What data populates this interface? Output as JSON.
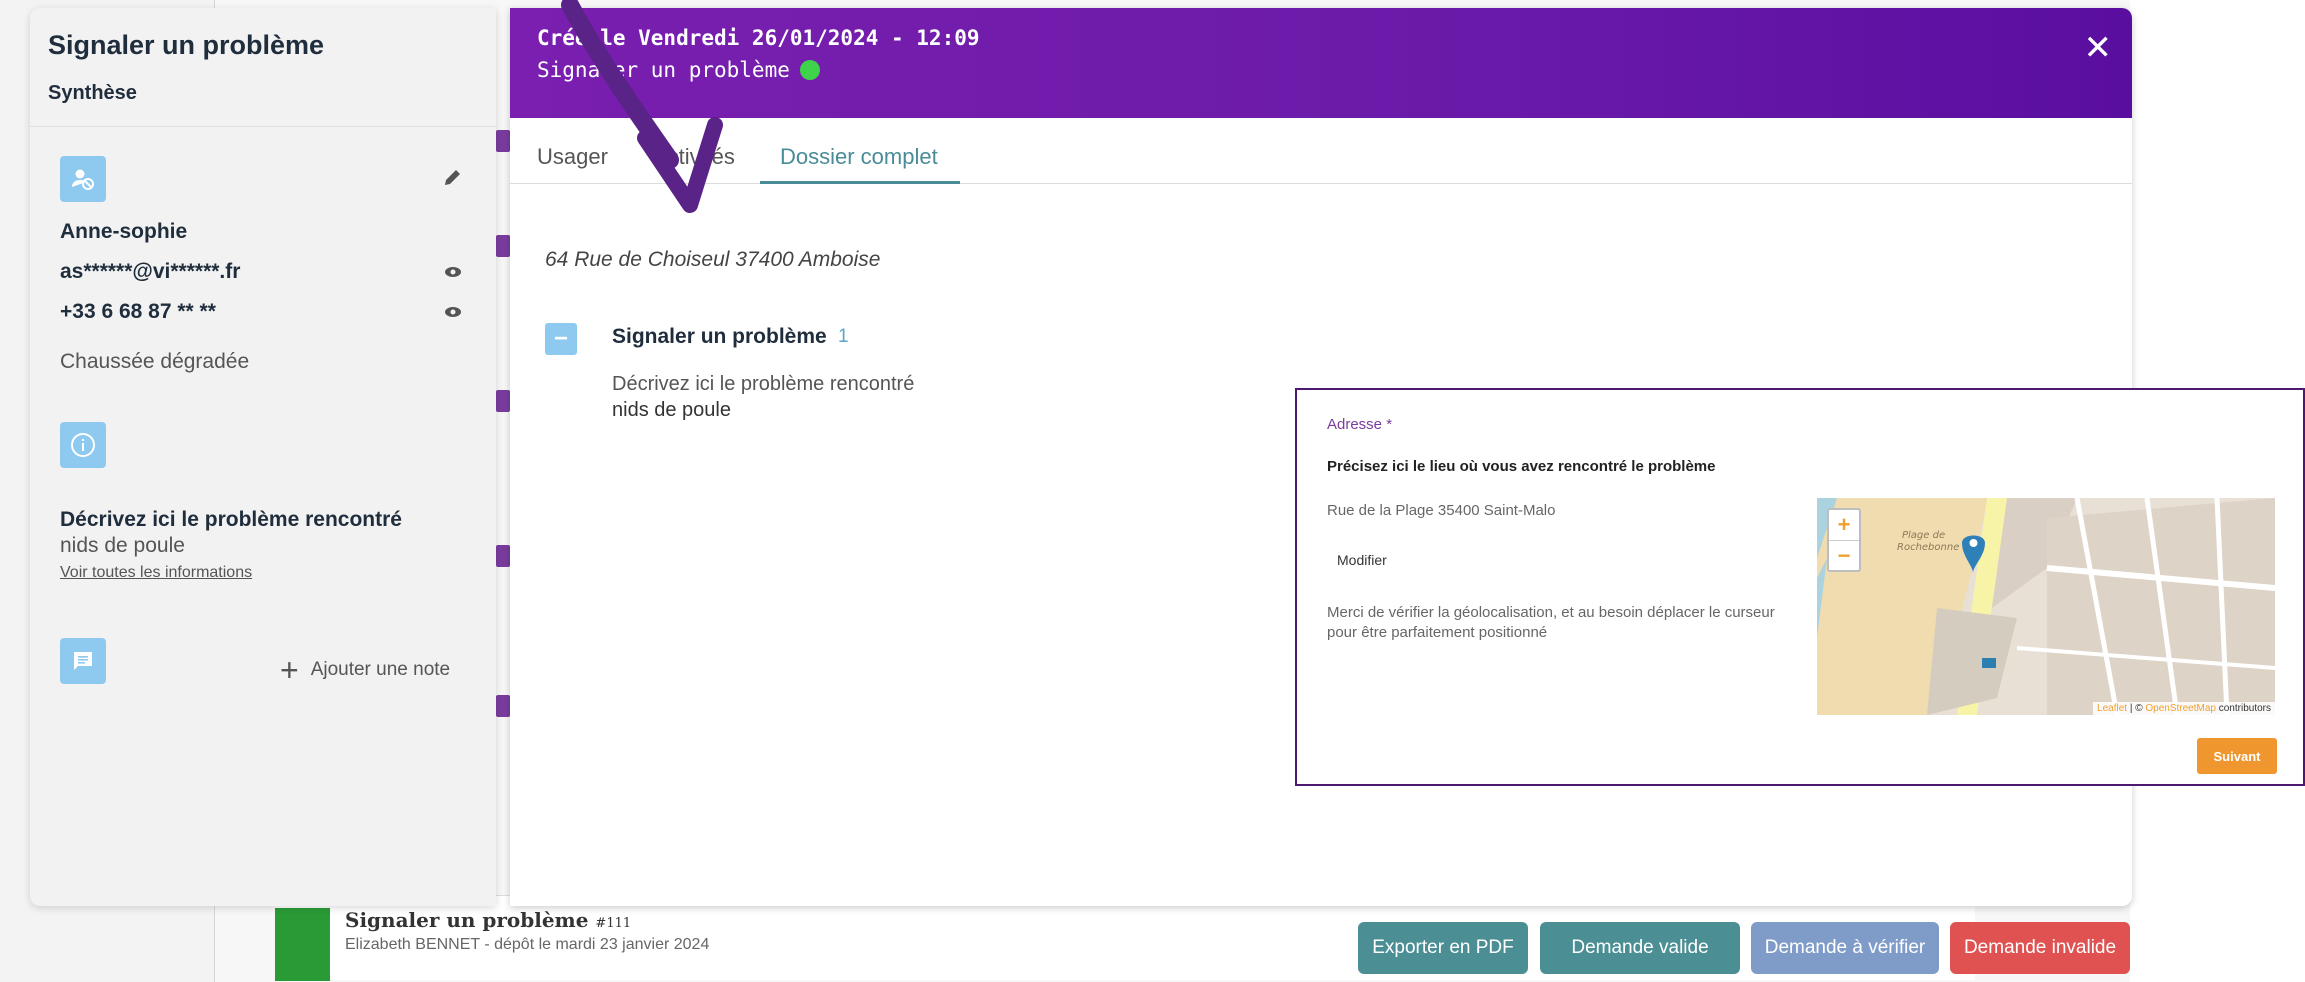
{
  "synthesis": {
    "title": "Signaler un problème",
    "subtitle": "Synthèse",
    "user": {
      "name": "Anne-sophie",
      "email": "as******@vi******.fr",
      "phone": "+33 6 68 87 ** **"
    },
    "category": "Chaussée dégradée",
    "question": "Décrivez ici le problème rencontré",
    "answer": "nids de poule",
    "see_all_link": "Voir toutes les informations",
    "add_note_label": "Ajouter une note"
  },
  "modal": {
    "title": "Créé le Vendredi 26/01/2024 - 12:09",
    "subtitle": "Signaler un problème",
    "close_icon": "close-icon",
    "status_color": "#3fd34b",
    "tabs": [
      {
        "label": "Usager"
      },
      {
        "label": "Activités"
      },
      {
        "label": "Dossier complet"
      }
    ],
    "active_tab": "Dossier complet",
    "address": "64 Rue de Choiseul 37400 Amboise",
    "section": {
      "title": "Signaler un problème",
      "count": "1",
      "field_label": "Décrivez ici le problème rencontré",
      "field_value": "nids de poule"
    }
  },
  "popup": {
    "label": "Adresse *",
    "question": "Précisez ici le lieu où vous avez rencontré le problème",
    "address": "Rue de la Plage 35400 Saint-Malo",
    "modify_label": "Modifier",
    "help": "Merci de vérifier la géolocalisation, et au besoin déplacer le curseur pour être parfaitement positionné",
    "map": {
      "zoom_in": "+",
      "zoom_out": "−",
      "place_label": "Plage de Rochebonne",
      "attribution_leaflet": "Leaflet",
      "attribution_sep": " | © ",
      "attribution_osm": "OpenStreetMap",
      "attribution_tail": " contributors"
    },
    "next_label": "Suivant"
  },
  "background": {
    "row_title": "Signaler un problème",
    "row_number": "#111",
    "row_subtitle": "Elizabeth BENNET - dépôt le mardi 23 janvier 2024"
  },
  "actions": {
    "export_pdf": "Exporter en PDF",
    "valid": "Demande valide",
    "to_verify": "Demande à vérifier",
    "invalid": "Demande invalide"
  },
  "colors": {
    "header_gradient_start": "#7a1fb0",
    "accent_teal": "#4a8b98",
    "action_export": "#4b8f95",
    "action_valid": "#4b8f95",
    "action_verify": "#7f9cc9",
    "action_invalid": "#e05252"
  }
}
